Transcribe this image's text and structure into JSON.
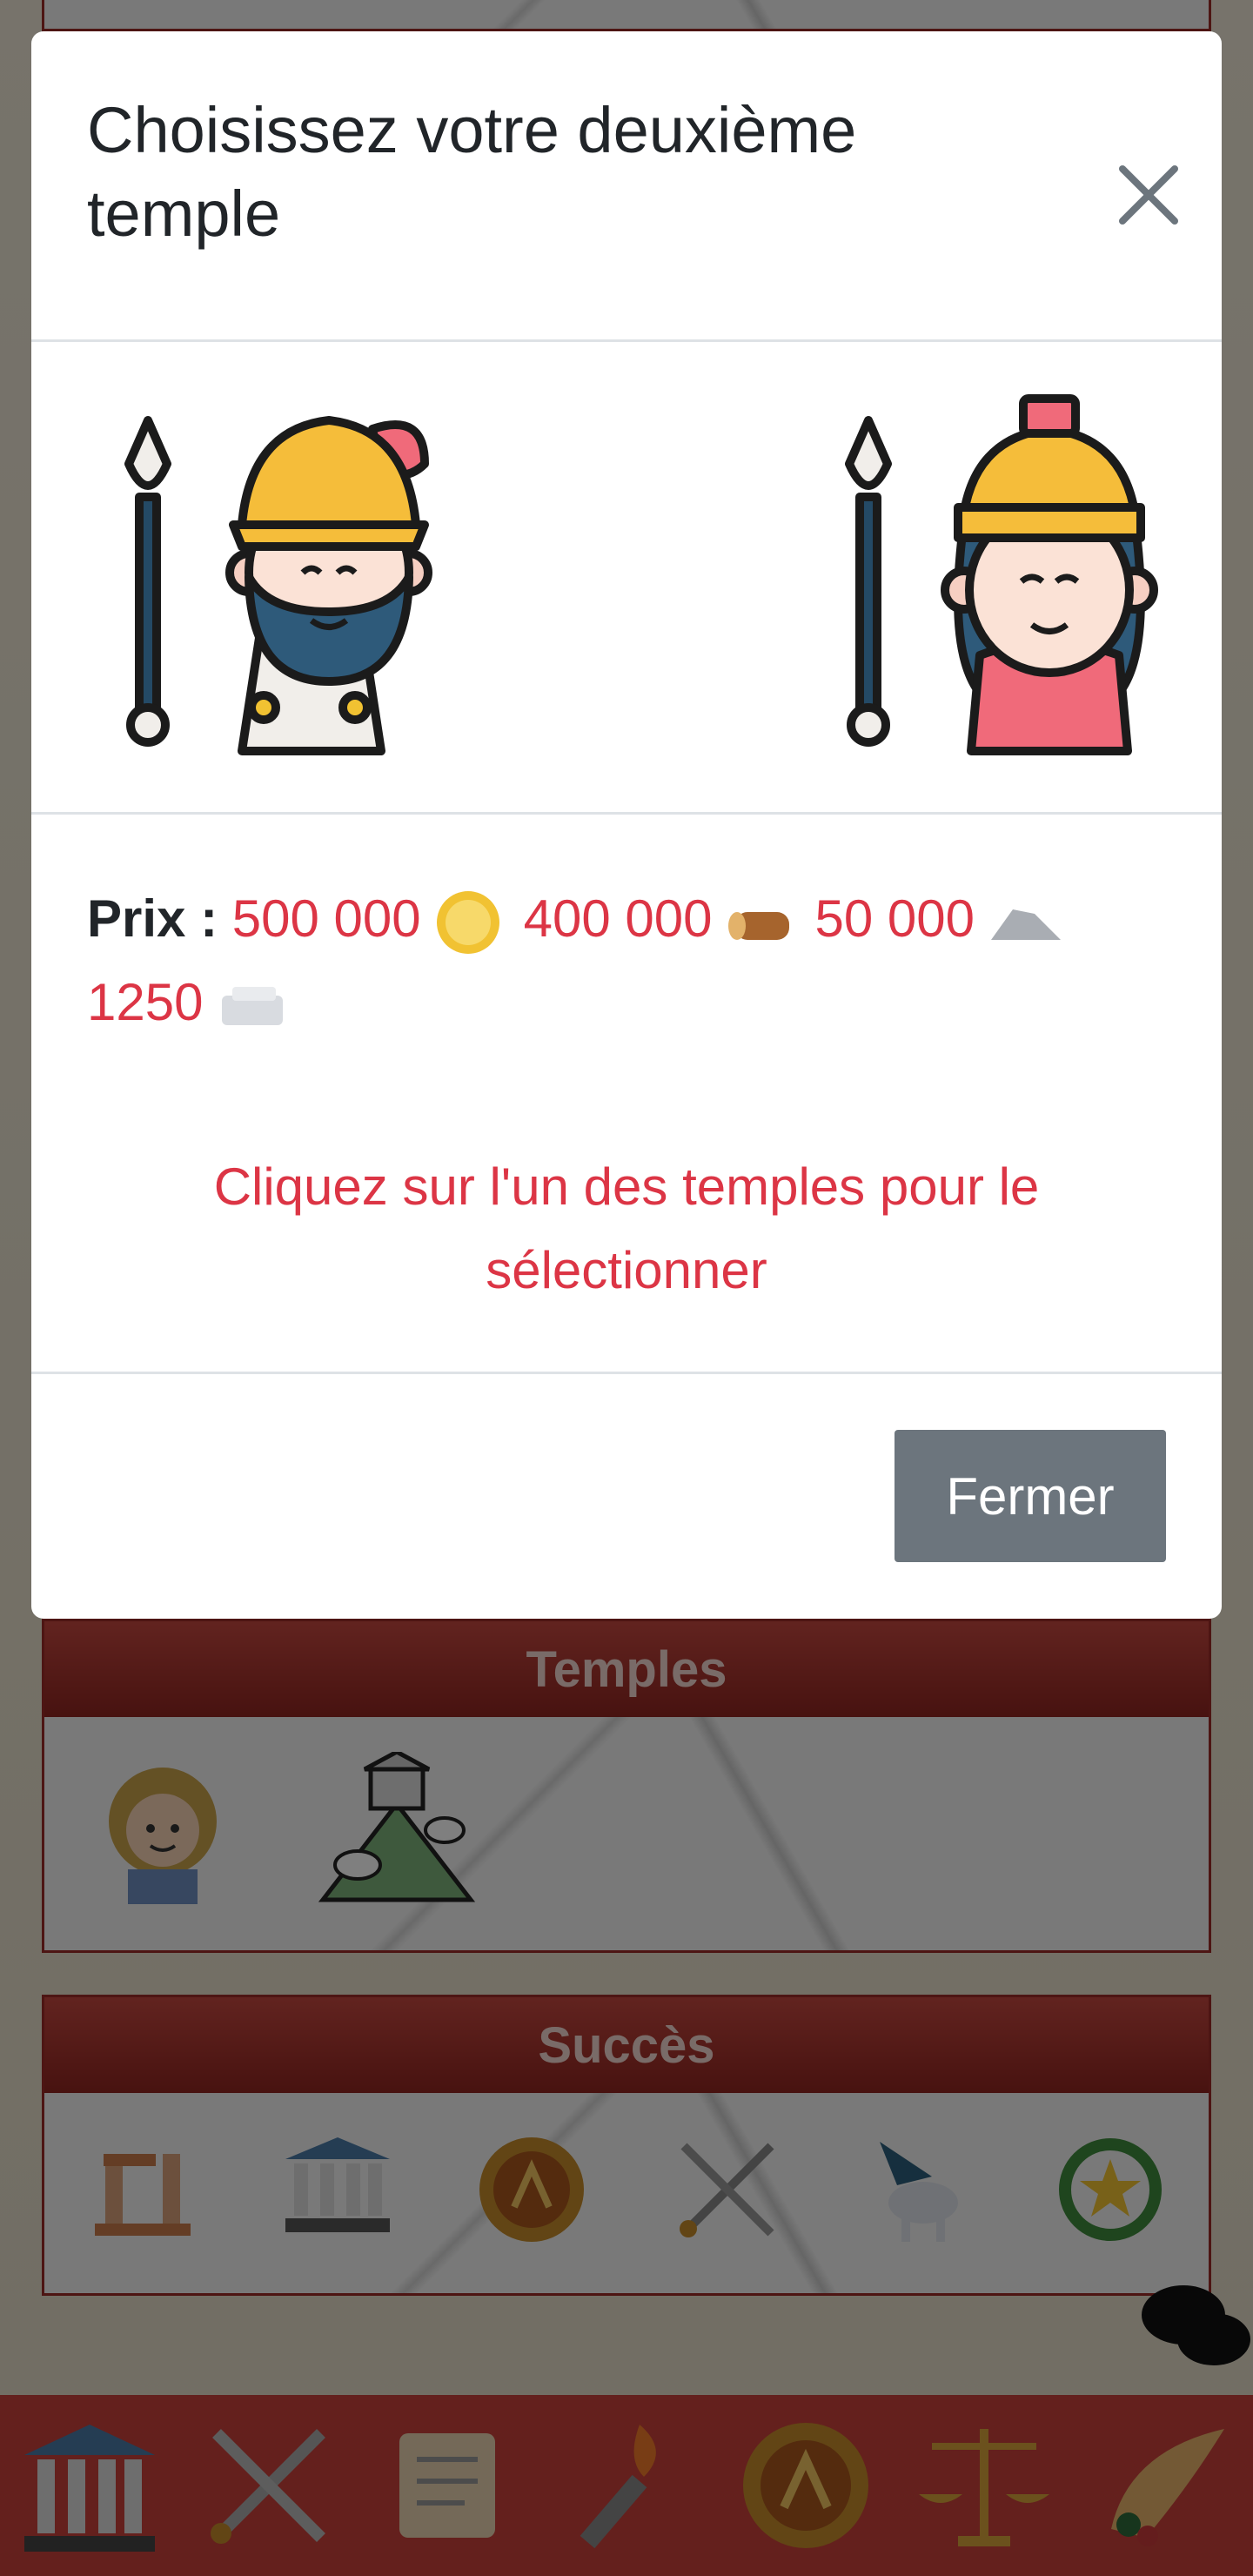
{
  "modal": {
    "title": "Choisissez votre deuxième temple",
    "close_icon": "close-icon",
    "gods": [
      {
        "name": "male-warrior-god-icon"
      },
      {
        "name": "female-warrior-goddess-icon"
      }
    ],
    "price": {
      "label": "Prix :",
      "items": [
        {
          "value": "500 000",
          "icon": "gold-coin-icon"
        },
        {
          "value": "400 000",
          "icon": "wood-log-icon"
        },
        {
          "value": "50 000",
          "icon": "stone-icon"
        },
        {
          "value": "1250",
          "icon": "marble-icon"
        }
      ]
    },
    "hint": "Cliquez sur l'un des temples pour le sélectionner",
    "footer_button": "Fermer"
  },
  "background": {
    "temples": {
      "title": "Temples",
      "items": [
        "apollo-icon",
        "olympus-mountain-icon"
      ]
    },
    "achievements": {
      "title": "Succès",
      "items": [
        "ruins-icon",
        "temple-icon",
        "spartan-shield-icon",
        "crossed-swords-icon",
        "pegasus-icon",
        "laurel-star-icon"
      ]
    },
    "bottom_nav": [
      "temple-icon",
      "swords-icon",
      "scroll-icon",
      "torch-icon",
      "shield-icon",
      "scales-icon",
      "cornucopia-icon"
    ],
    "chat": "chat-icon"
  },
  "colors": {
    "accent_red": "#dc3545",
    "nav_red": "#c9403a",
    "button_grey": "#6c757d"
  }
}
